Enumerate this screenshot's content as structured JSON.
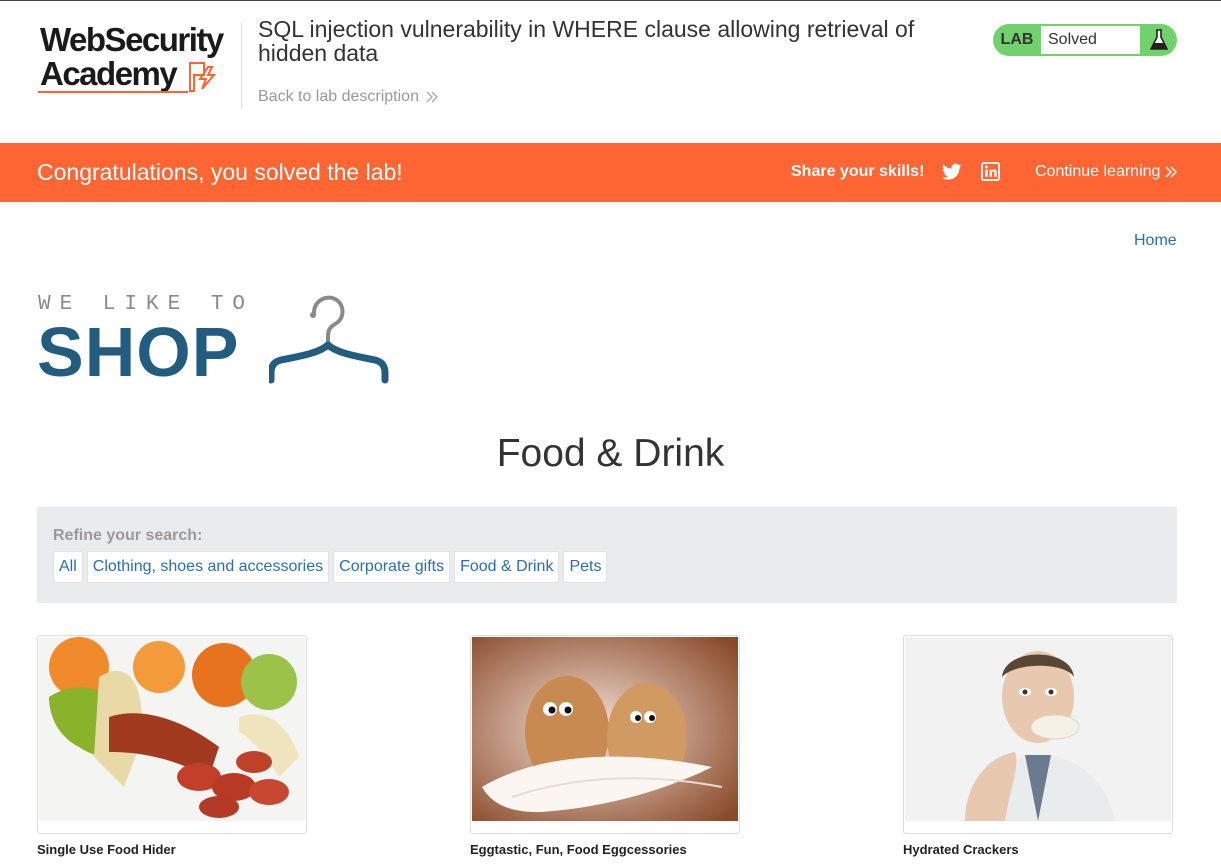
{
  "header": {
    "logo_line1": "WebSecurity",
    "logo_line2": "Academy",
    "lab_title": "SQL injection vulnerability in WHERE clause allowing retrieval of hidden data",
    "back_link": "Back to lab description",
    "lab_tag": "LAB",
    "lab_state": "Solved",
    "status_color": "#70d16d"
  },
  "banner": {
    "message": "Congratulations, you solved the lab!",
    "share_label": "Share your skills!",
    "continue_label": "Continue learning",
    "color": "#ff6633",
    "icons": [
      "twitter-icon",
      "linkedin-icon"
    ]
  },
  "nav": {
    "home": "Home"
  },
  "shop_logo": {
    "tagline": "WE LIKE TO",
    "word": "SHOP"
  },
  "page": {
    "title": "Food & Drink"
  },
  "refine": {
    "label": "Refine your search:",
    "filters": [
      "All",
      "Clothing, shoes and accessories",
      "Corporate gifts",
      "Food & Drink",
      "Pets"
    ]
  },
  "products": [
    {
      "name": "Single Use Food Hider"
    },
    {
      "name": "Eggtastic, Fun, Food Eggcessories"
    },
    {
      "name": "Hydrated Crackers"
    }
  ],
  "colors": {
    "link": "#2b6fad",
    "brand_blue": "#225d80",
    "accent": "#ff6633"
  }
}
